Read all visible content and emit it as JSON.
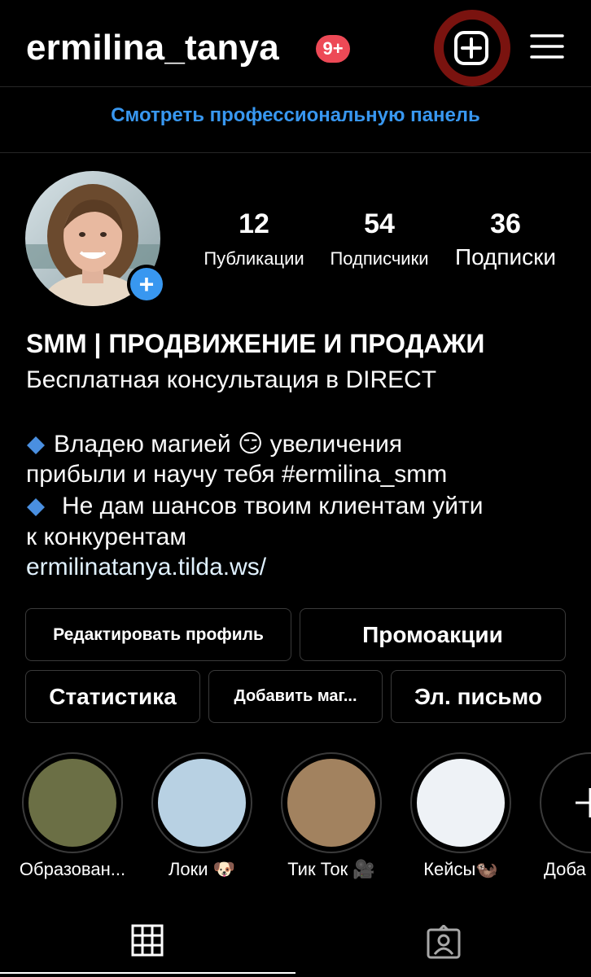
{
  "header": {
    "username": "ermilina_tanya",
    "notifications_badge": "9+",
    "new_post_icon": "plus-square-icon",
    "menu_icon": "hamburger-menu-icon"
  },
  "professional_panel_link": "Смотреть профессиональную панель",
  "profile": {
    "stats": [
      {
        "value": "12",
        "label": "Публикации"
      },
      {
        "value": "54",
        "label": "Подписчики"
      },
      {
        "value": "36",
        "label": "Подписки"
      }
    ],
    "bio": {
      "title": "SMM | ПРОДВИЖЕНИЕ И ПРОДАЖИ",
      "line1": "Бесплатная консультация в DIRECT",
      "line2_a": "Владею магией",
      "line2_emoji": "😏",
      "line2_b": "увеличения",
      "line3_a": "прибыли и научу тебя ",
      "line3_hashtag": "#ermilina_smm",
      "line4": "Не дам шансов твоим клиентам уйти",
      "line5": "к конкурентам",
      "link": "ermilinatanya.tilda.ws/"
    }
  },
  "buttons": {
    "edit_profile": "Редактировать профиль",
    "promotions": "Промоакции",
    "statistics": "Статистика",
    "add_shop": "Добавить маг...",
    "email": "Эл. письмо"
  },
  "highlights": [
    {
      "label": "Образован...",
      "color": "#6b6f45"
    },
    {
      "label": "Локи 🐶",
      "color": "#b8d1e3"
    },
    {
      "label": "Тик Ток 🎥",
      "color": "#a2825f"
    },
    {
      "label": "Кейсы🦦",
      "color": "#eef2f6"
    },
    {
      "label": "Доба",
      "icon": "plus-icon"
    }
  ],
  "tabs": [
    {
      "name": "grid",
      "icon": "grid-icon"
    },
    {
      "name": "tagged",
      "icon": "tagged-person-icon"
    }
  ],
  "colors": {
    "accent_blue": "#3897f0",
    "badge_red": "#ed4956",
    "highlight_ring": "#7a130f"
  }
}
